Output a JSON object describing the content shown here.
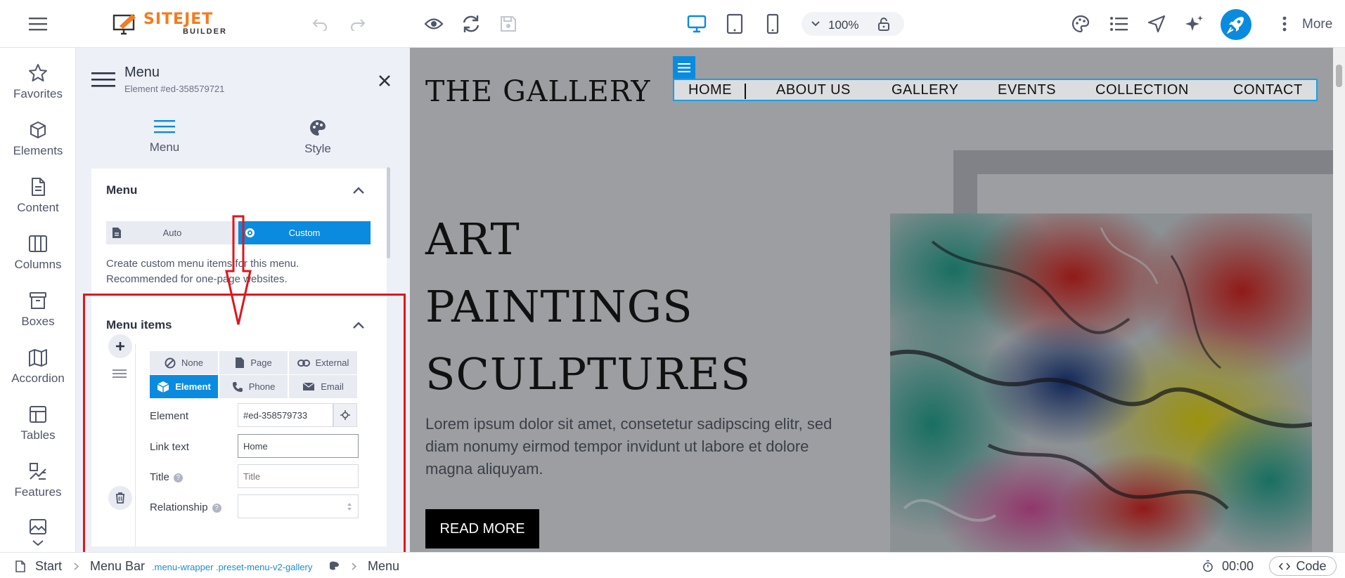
{
  "app": {
    "logo_main": "SITEJET",
    "logo_sub": "BUILDER",
    "zoom": "100%",
    "more_label": "More"
  },
  "rail": {
    "items": [
      {
        "label": "Favorites",
        "icon": "star-icon"
      },
      {
        "label": "Elements",
        "icon": "cube-icon"
      },
      {
        "label": "Content",
        "icon": "document-icon"
      },
      {
        "label": "Columns",
        "icon": "columns-icon"
      },
      {
        "label": "Boxes",
        "icon": "box-icon"
      },
      {
        "label": "Accordion",
        "icon": "accordion-icon"
      },
      {
        "label": "Tables",
        "icon": "table-icon"
      },
      {
        "label": "Features",
        "icon": "features-icon"
      }
    ]
  },
  "panel": {
    "title": "Menu",
    "subtitle": "Element #ed-358579721",
    "tabs": [
      {
        "label": "Menu",
        "active": true
      },
      {
        "label": "Style",
        "active": false
      }
    ],
    "menu_card": {
      "title": "Menu",
      "options": [
        "Auto",
        "Custom"
      ],
      "selected": "Custom",
      "help": "Create custom menu items for this menu. Recommended for one-page websites."
    },
    "items_card": {
      "title": "Menu items",
      "link_types": [
        "None",
        "Page",
        "External",
        "Element",
        "Phone",
        "Email"
      ],
      "selected_type": "Element",
      "element_label": "Element",
      "element_value": "#ed-358579733",
      "link_text_label": "Link text",
      "link_text_value": "Home",
      "title_label": "Title",
      "title_placeholder": "Title",
      "relationship_label": "Relationship"
    }
  },
  "site": {
    "title": "THE GALLERY",
    "nav": [
      "HOME",
      "ABOUT US",
      "GALLERY",
      "EVENTS",
      "COLLECTION",
      "CONTACT"
    ],
    "heading_lines": [
      "ART",
      "PAINTINGS",
      "SCULPTURES"
    ],
    "body": "Lorem ipsum dolor sit amet, consetetur sadipscing elitr, sed diam nonumy eirmod tempor invidunt ut labore et dolore magna aliquyam.",
    "button": "READ MORE"
  },
  "status_bar": {
    "start": "Start",
    "menu_bar": "Menu Bar",
    "classes": ".menu-wrapper .preset-menu-v2-gallery",
    "menu": "Menu",
    "timer": "00:00",
    "code": "Code"
  },
  "colors": {
    "accent": "#0a8be0",
    "brand": "#f47b20",
    "annotation": "#e0161b"
  }
}
